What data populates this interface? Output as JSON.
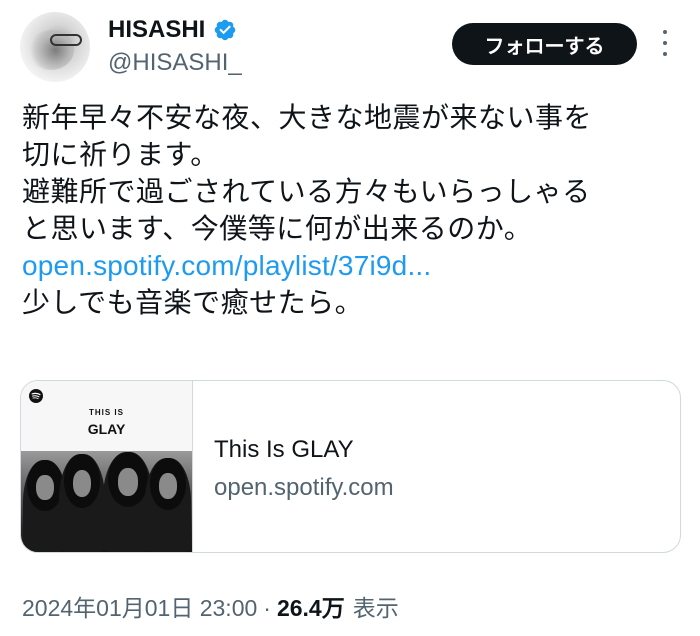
{
  "author": {
    "display_name": "HISASHI",
    "handle": "@HISASHI_",
    "verified": true
  },
  "actions": {
    "follow_label": "フォローする",
    "more_icon": "more-vertical-icon"
  },
  "tweet": {
    "lines": [
      "新年早々不安な夜、大きな地震が来ない事を",
      "切に祈ります。",
      "避難所で過ごされている方々もいらっしゃる",
      "と思います、今僕等に何が出来るのか。"
    ],
    "link_text": "open.spotify.com/playlist/37i9d...",
    "last_line": "少しでも音楽で癒せたら。"
  },
  "card": {
    "thumb_small_text": "THIS IS",
    "thumb_big_text": "GLAY",
    "title": "This Is GLAY",
    "domain": "open.spotify.com",
    "icon": "spotify-icon"
  },
  "meta": {
    "timestamp": "2024年01月01日 23:00",
    "separator": "·",
    "views_count": "26.4万",
    "views_label": "表示"
  },
  "colors": {
    "text": "#0f1419",
    "secondary": "#536471",
    "link": "#1d9bf0",
    "verified": "#1d9bf0",
    "border": "#cfd9de",
    "button": "#0f1419"
  }
}
